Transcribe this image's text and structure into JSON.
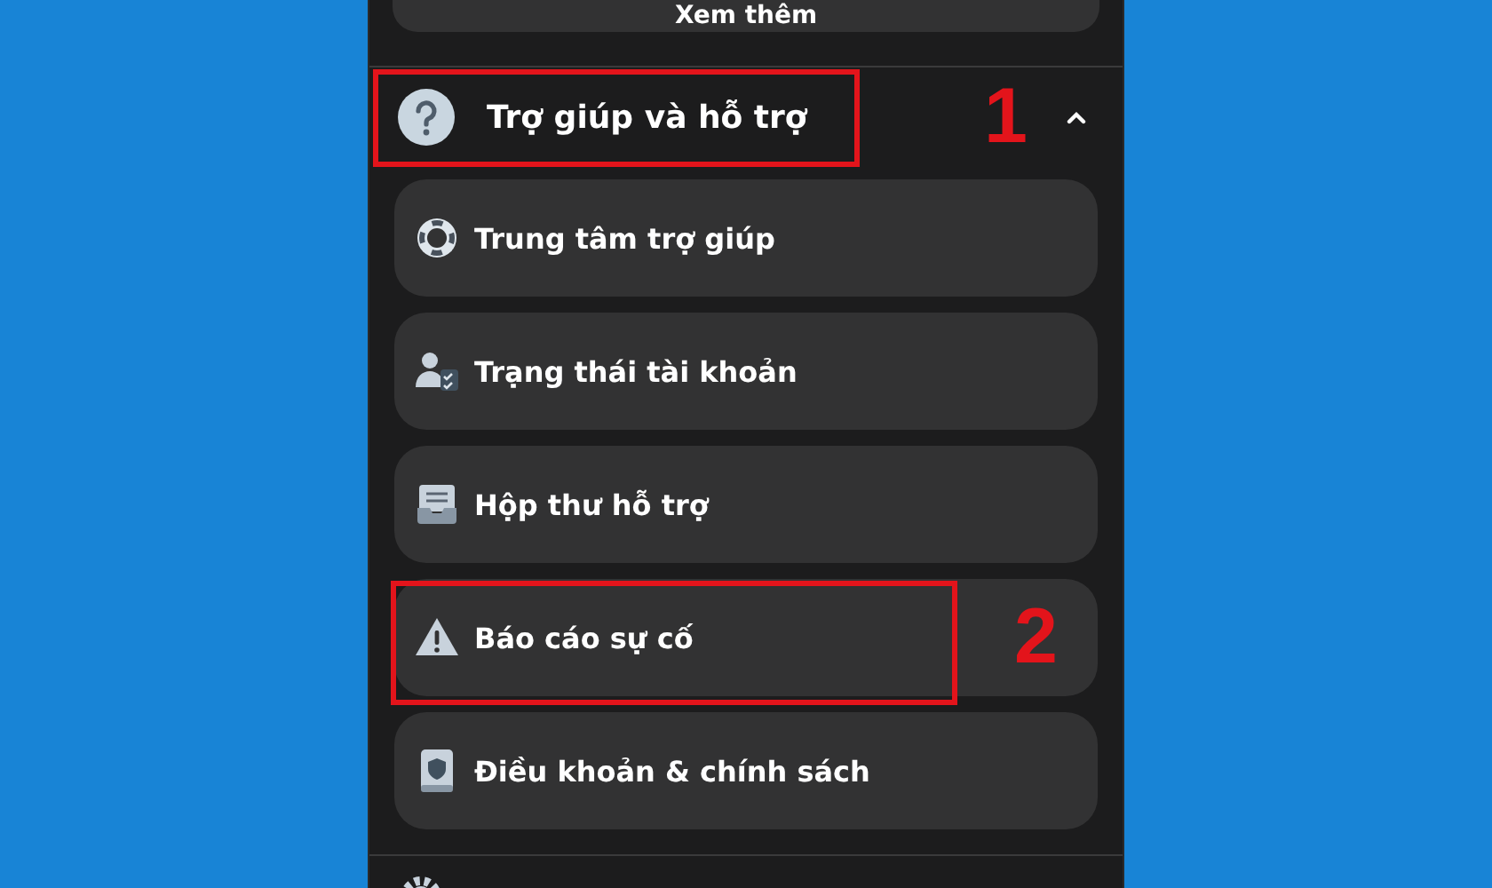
{
  "more_button": {
    "label": "Xem thêm"
  },
  "section": {
    "title": "Trợ giúp và hỗ trợ",
    "expanded": true,
    "callout": "1"
  },
  "items": [
    {
      "label": "Trung tâm trợ giúp"
    },
    {
      "label": "Trạng thái tài khoản"
    },
    {
      "label": "Hộp thư hỗ trợ"
    },
    {
      "label": "Báo cáo sự cố",
      "callout": "2"
    },
    {
      "label": "Điều khoản & chính sách"
    }
  ]
}
